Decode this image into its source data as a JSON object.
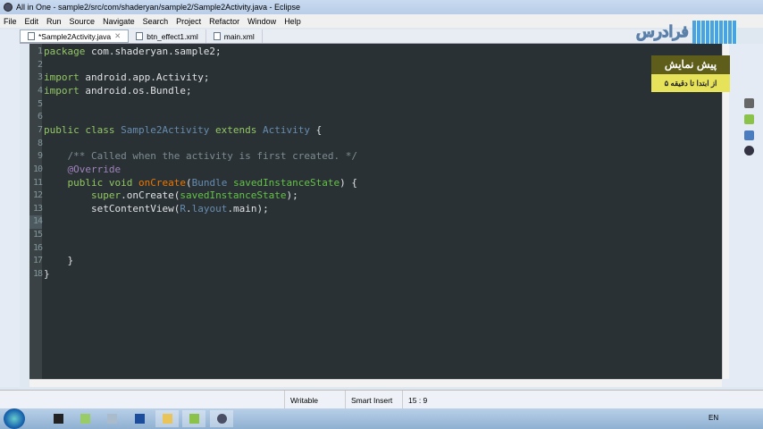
{
  "window": {
    "title": "All in One - sample2/src/com/shaderyan/sample2/Sample2Activity.java - Eclipse"
  },
  "menu": [
    "File",
    "Edit",
    "Run",
    "Source",
    "Navigate",
    "Search",
    "Project",
    "Refactor",
    "Window",
    "Help"
  ],
  "tabs": [
    {
      "label": "*Sample2Activity.java",
      "close": "✕"
    },
    {
      "label": "btn_effect1.xml"
    },
    {
      "label": "main.xml"
    }
  ],
  "code": [
    [
      [
        "keyword",
        "package"
      ],
      [
        "plain",
        " com.shaderyan.sample2;"
      ]
    ],
    [],
    [
      [
        "keyword",
        "import"
      ],
      [
        "plain",
        " android.app.Activity;"
      ]
    ],
    [
      [
        "keyword",
        "import"
      ],
      [
        "plain",
        " android.os.Bundle;"
      ]
    ],
    [],
    [],
    [
      [
        "keyword",
        "public class "
      ],
      [
        "cls",
        "Sample2Activity"
      ],
      [
        "keyword",
        " extends "
      ],
      [
        "cls",
        "Activity"
      ],
      [
        "plain",
        " {"
      ]
    ],
    [],
    [
      [
        "comment",
        "    /** Called when the activity is first created. */"
      ]
    ],
    [
      [
        "annot",
        "    @Override"
      ]
    ],
    [
      [
        "keyword",
        "    public void "
      ],
      [
        "method",
        "onCreate"
      ],
      [
        "plain",
        "("
      ],
      [
        "cls",
        "Bundle"
      ],
      [
        "param",
        " savedInstanceState"
      ],
      [
        "plain",
        ") {"
      ]
    ],
    [
      [
        "keyword",
        "        super"
      ],
      [
        "plain",
        ".onCreate("
      ],
      [
        "param",
        "savedInstanceState"
      ],
      [
        "plain",
        ");"
      ]
    ],
    [
      [
        "plain",
        "        setContentView("
      ],
      [
        "cls",
        "R"
      ],
      [
        "plain",
        "."
      ],
      [
        "field",
        "layout"
      ],
      [
        "plain",
        ".main);"
      ]
    ],
    [],
    [],
    [],
    [
      [
        "plain",
        "    }"
      ]
    ],
    [
      [
        "plain",
        "}"
      ]
    ]
  ],
  "status": {
    "mode": "Writable",
    "insert": "Smart Insert",
    "position": "15 : 9"
  },
  "ad": {
    "logo": "فرادرس",
    "title": "پیش نمایش",
    "subtitle": "از ابتدا تا دقیقه ۵"
  },
  "taskbar": {
    "lang": "EN"
  }
}
